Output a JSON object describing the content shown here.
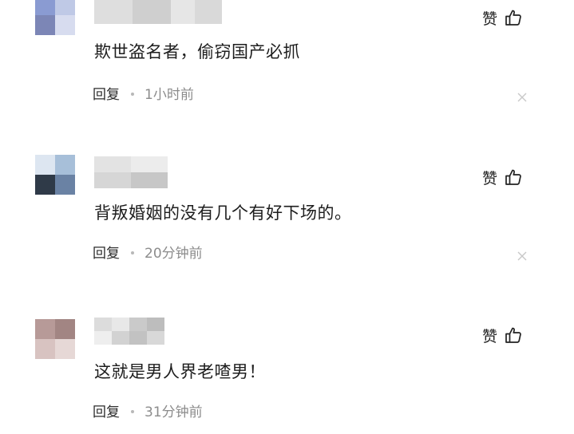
{
  "comments": [
    {
      "text": "欺世盗名者，偷窃国产必抓",
      "reply_label": "回复",
      "time": "1小时前",
      "like_label": "赞"
    },
    {
      "text": "背叛婚姻的没有几个有好下场的。",
      "reply_label": "回复",
      "time": "20分钟前",
      "like_label": "赞"
    },
    {
      "text": "这就是男人界老喳男！",
      "reply_label": "回复",
      "time": "31分钟前",
      "like_label": "赞"
    }
  ],
  "icons": {
    "like": "thumbs-up-icon",
    "close": "close-icon",
    "avatar": "pixelated-avatar",
    "username": "pixelated-username"
  },
  "colors": {
    "text": "#1d1d1d",
    "time": "#8c8c8c",
    "dot": "#b8b8b8",
    "close": "#c8c8c8"
  }
}
